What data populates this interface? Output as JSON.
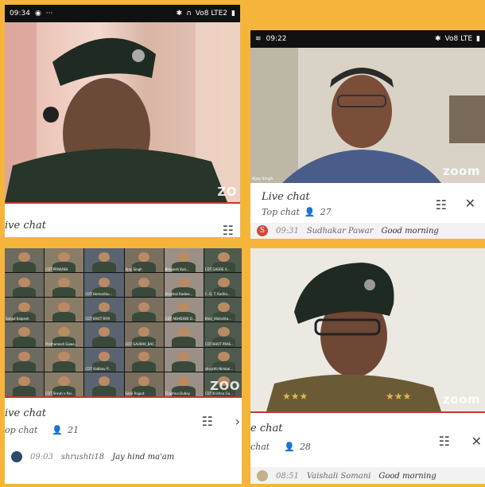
{
  "panels": {
    "top_left": {
      "status": {
        "time": "09:34",
        "right": "Vo8 LTE2"
      },
      "chat_title": "ive chat",
      "zoom": "ZO"
    },
    "top_right": {
      "status": {
        "time": "09:22",
        "right": "Vo8 LTE"
      },
      "video_caption": "Ajay Singh",
      "zoom": "zoom",
      "chat_title": "Live chat",
      "chat_sub": "Top chat",
      "viewers": "27",
      "msg_avatar": "S",
      "msg_time": "09:31",
      "msg_user": "Sudhakar Pawar",
      "msg_text": "Good morning"
    },
    "bottom_left": {
      "zoom": "ZOO",
      "chat_title": "ive chat",
      "chat_sub": "op chat",
      "viewers": "21",
      "msg_time": "09:03",
      "msg_user": "shrushti18",
      "msg_text": "Jay hind ma'am",
      "tiles": [
        "",
        "CDT PRAKASH",
        "",
        "Ajay Singh",
        "Bhupesh Kuls...",
        "CDT GAGRE V...",
        "",
        "",
        "CDT Hemantku...",
        "",
        "Vrushali Kadwe...",
        "C. D. T. Kadha...",
        "Sahad Kalpesh",
        "",
        "CDT KHOT RIYA",
        "",
        "CDT ABHISHEK D...",
        "Bhol_Vibhishta...",
        "",
        "Prathamesh Gawa...",
        "",
        "CDT GAURAV_BAC...",
        "",
        "CDT KHOT PRAS...",
        "",
        "",
        "CDT Vaibhav P...",
        "",
        "",
        "shrushti Nimbal...",
        "",
        "CDT Shruti v Rai...",
        "",
        "Sahil Rajput",
        "Tirashna Dubey",
        "CDT Krishna Ga..."
      ]
    },
    "bottom_right": {
      "zoom": "zoom",
      "chat_title": "e chat",
      "chat_sub": "chat",
      "viewers": "28",
      "msg_time": "08:51",
      "msg_user": "Vaishali Somani",
      "msg_text": "Good morning"
    }
  },
  "colors": {
    "frame": "#f5b53a",
    "accent": "#c0392b",
    "status_bg": "#111111"
  },
  "icons": [
    "filter-icon",
    "close-icon",
    "person-icon",
    "wifi-icon",
    "bluetooth-icon",
    "headphones-icon",
    "battery-icon"
  ]
}
